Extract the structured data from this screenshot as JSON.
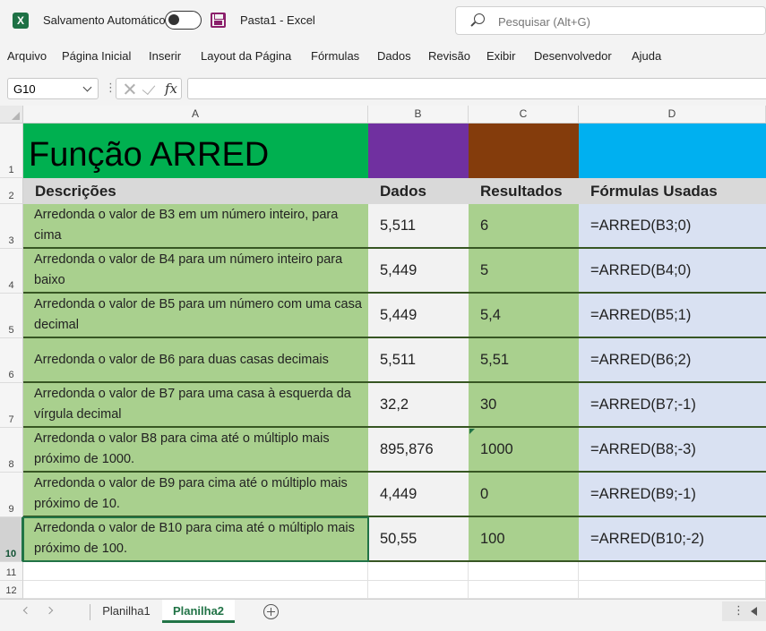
{
  "app": {
    "logo": "X",
    "autosave_label": "Salvamento Automático",
    "document_title": "Pasta1  -  Excel",
    "search_placeholder": "Pesquisar (Alt+G)"
  },
  "menu": [
    "Arquivo",
    "Página Inicial",
    "Inserir",
    "Layout da Página",
    "Fórmulas",
    "Dados",
    "Revisão",
    "Exibir",
    "Desenvolvedor",
    "Ajuda"
  ],
  "formula_bar": {
    "name_box": "G10",
    "dots": "⋮",
    "formula_value": ""
  },
  "columns": [
    "A",
    "B",
    "C",
    "D"
  ],
  "rows": [
    "1",
    "2",
    "3",
    "4",
    "5",
    "6",
    "7",
    "8",
    "9",
    "10",
    "11",
    "12"
  ],
  "sheet": {
    "title": "Função ARRED",
    "headers": {
      "descricoes": "Descrições",
      "dados": "Dados",
      "resultados": "Resultados",
      "formulas": "Fórmulas Usadas"
    },
    "data_rows": [
      {
        "desc": "Arredonda o valor de B3 em um número inteiro, para cima",
        "dados": "5,511",
        "res": "6",
        "formula": "=ARRED(B3;0)"
      },
      {
        "desc": "Arredonda o valor de B4 para um número inteiro para baixo",
        "dados": "5,449",
        "res": "5",
        "formula": "=ARRED(B4;0)"
      },
      {
        "desc": "Arredonda o valor de B5 para um número com uma casa decimal",
        "dados": "5,449",
        "res": "5,4",
        "formula": "=ARRED(B5;1)"
      },
      {
        "desc": "Arredonda o valor de B6 para duas casas decimais",
        "dados": "5,511",
        "res": "5,51",
        "formula": "=ARRED(B6;2)"
      },
      {
        "desc": "Arredonda o valor de B7 para uma casa à esquerda da vírgula decimal",
        "dados": "32,2",
        "res": "30",
        "formula": "=ARRED(B7;-1)"
      },
      {
        "desc": "Arredonda o valor B8 para cima até o múltiplo mais próximo de 1000.",
        "dados": "895,876",
        "res": "1000",
        "formula": "=ARRED(B8;-3)"
      },
      {
        "desc": "Arredonda o valor de B9 para cima até o múltiplo mais próximo de 10.",
        "dados": "4,449",
        "res": "0",
        "formula": "=ARRED(B9;-1)"
      },
      {
        "desc": "Arredonda o valor de B10 para cima até o múltiplo mais próximo de 100.",
        "dados": "50,55",
        "res": "100",
        "formula": "=ARRED(B10;-2)"
      }
    ]
  },
  "tabs": [
    "Planilha1",
    "Planilha2"
  ],
  "active_tab": "Planilha2",
  "scroll_more": "⋮",
  "colors": {
    "title_fill": "#00b050",
    "b1_fill": "#7030a0",
    "c1_fill": "#843c0c",
    "d1_fill": "#00b0f0",
    "desc_fill": "#a9d08e",
    "formula_fill": "#d9e1f2",
    "excel_green": "#217346"
  }
}
